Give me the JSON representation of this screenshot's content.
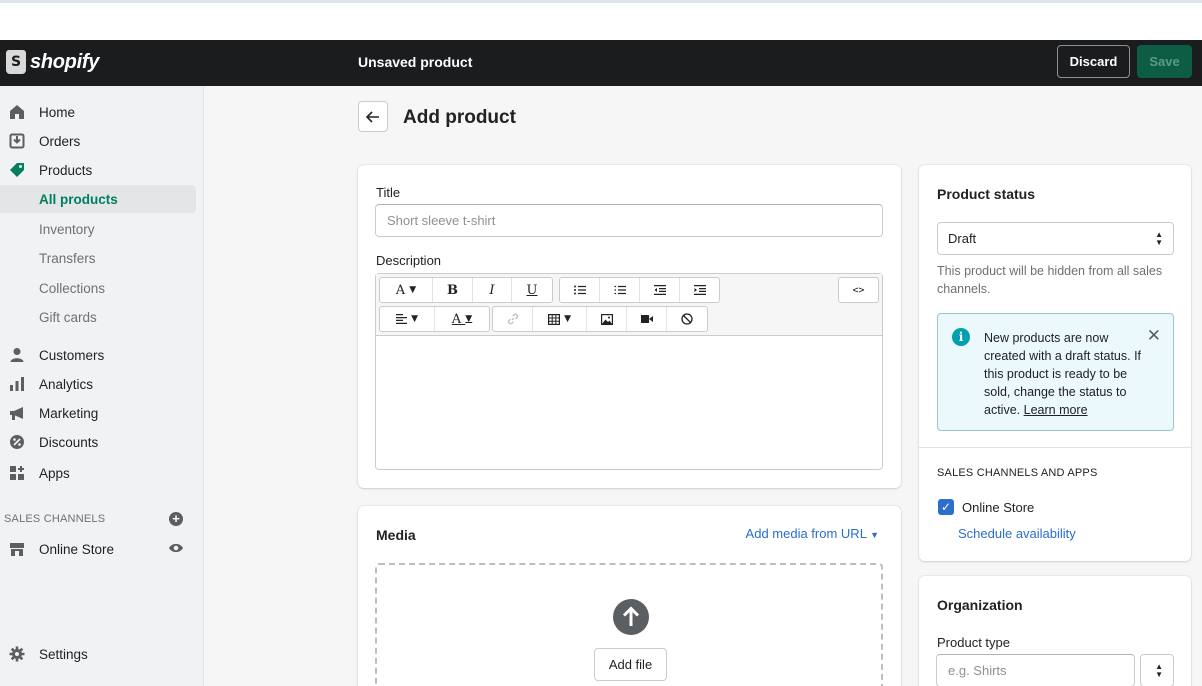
{
  "app": {
    "brand": "shopify",
    "window_title": "Unsaved product"
  },
  "topbar": {
    "discard_label": "Discard",
    "save_label": "Save"
  },
  "sidebar": {
    "items": [
      {
        "label": "Home",
        "icon": "home-icon"
      },
      {
        "label": "Orders",
        "icon": "orders-icon"
      },
      {
        "label": "Products",
        "icon": "tag-icon"
      },
      {
        "label": "All products",
        "icon": ""
      },
      {
        "label": "Inventory",
        "icon": ""
      },
      {
        "label": "Transfers",
        "icon": ""
      },
      {
        "label": "Collections",
        "icon": ""
      },
      {
        "label": "Gift cards",
        "icon": ""
      },
      {
        "label": "Customers",
        "icon": "person-icon"
      },
      {
        "label": "Analytics",
        "icon": "bar-chart-icon"
      },
      {
        "label": "Marketing",
        "icon": "megaphone-icon"
      },
      {
        "label": "Discounts",
        "icon": "discount-icon"
      },
      {
        "label": "Apps",
        "icon": "apps-icon"
      }
    ],
    "sales_channels_heading": "SALES CHANNELS",
    "online_store": "Online Store",
    "settings": "Settings"
  },
  "page": {
    "title": "Add product",
    "back_icon": "arrow-left-icon"
  },
  "product_form": {
    "title_label": "Title",
    "title_placeholder": "Short sleeve t-shirt",
    "description_label": "Description",
    "toolbar": {
      "font": "A",
      "bold": "B",
      "italic": "I",
      "underline": "U",
      "code": "<>",
      "color": "A"
    }
  },
  "media": {
    "heading": "Media",
    "add_from_url": "Add media from URL",
    "add_file": "Add file"
  },
  "product_status": {
    "heading": "Product status",
    "selected": "Draft",
    "hint": "This product will be hidden from all sales channels.",
    "banner_text": "New products are now created with a draft status. If this product is ready to be sold, change the status to active.",
    "banner_link": "Learn more",
    "channels_heading": "SALES CHANNELS AND APPS",
    "online_store": "Online Store",
    "schedule": "Schedule availability"
  },
  "organization": {
    "heading": "Organization",
    "product_type_label": "Product type",
    "product_type_placeholder": "e.g. Shirts"
  },
  "colors": {
    "accent": "#007f5f",
    "topbar": "#1a1c1d",
    "link": "#2c6ecb",
    "info": "#00a0ac"
  }
}
